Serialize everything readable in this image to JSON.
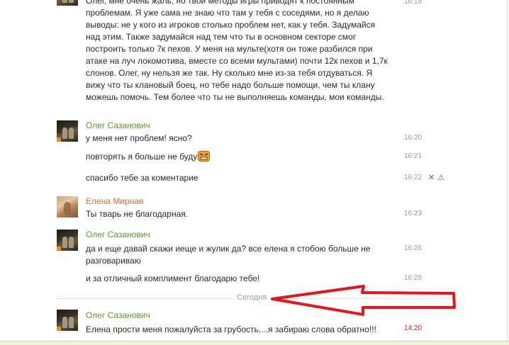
{
  "messages": [
    {
      "time": "16:18",
      "text": "Олег, мне очень жаль, но твои методы игры приводят к постоянным проблемам. Я уже сама не знаю что там у тебя с соседями, но я делаю выводы: не у кого из игроков столько проблем нет, как у тебя. Задумайся над этим. Также задумайся над тем что ты в основном секторе смог построить только 7к пехов. У меня на мульте(хотя он тоже разбился при атаке на луч локомотива, вместе со всеми мультами) почти 12к пехов и 1,7к слонов. Олег, ну нельзя же так. Ну сколько мне из-за тебя отдуваться. Я вижу что ты клановый боец, но тебе надо больше помощи, чем ты клану можешь помочь. Тем более что ты не выполняешь команды, мои команды."
    },
    {
      "author": "Олег Сазанович",
      "lines": [
        {
          "text": "у меня нет проблем! ясно?",
          "time": "16:20"
        },
        {
          "text": "повторять я больше не буду",
          "time": "16:21"
        },
        {
          "text": "спасибо тебе за коментарие",
          "time": "16:22"
        }
      ]
    },
    {
      "author": "Елена Мирная",
      "lines": [
        {
          "text": "Ты тварь не благодарная.",
          "time": "16:23"
        }
      ]
    },
    {
      "author": "Олег Сазанович",
      "lines": [
        {
          "text": "да и еще давай скажи иеще и жулик да? все елена я стобою больше не разговариваю",
          "time": "16:26"
        },
        {
          "text": "и за отличный комплимент благодарю тебе!",
          "time": "16:28"
        }
      ]
    },
    {
      "author": "Олег Сазанович",
      "lines": [
        {
          "text": "Елена прости меня пожалуйста за грубость....я забираю слова обратно!!!",
          "time": "14:20"
        }
      ]
    }
  ],
  "divider": {
    "label": "Сегодня"
  },
  "actions": {
    "delete": "✕",
    "report": "⚠"
  },
  "icons": {
    "avatar_badge": "orange-square-icon",
    "emoticon": "angry-smiley-icon",
    "annotation": "red-arrow"
  },
  "colors": {
    "author_male": "#5a9a2a",
    "author_female": "#e56c2f",
    "new_time": "#e0201a",
    "arrow": "#e8141c"
  }
}
